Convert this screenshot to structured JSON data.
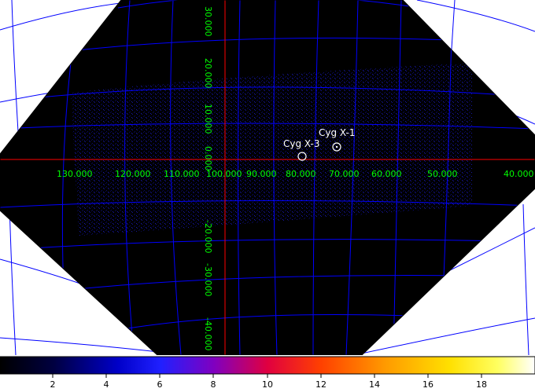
{
  "sky_map": {
    "ra_labels": [
      "130.000",
      "120.000",
      "110.000",
      "100.000",
      "90.000",
      "80.000",
      "70.000",
      "60.000",
      "50.000",
      "40.000"
    ],
    "dec_labels": [
      "30.000",
      "20.000",
      "10.000",
      "0.000",
      "-20.000",
      "-30.000",
      "-40.000"
    ],
    "sources": [
      {
        "name": "Cyg X-3",
        "label": "Cyg X-3"
      },
      {
        "name": "Cyg X-1",
        "label": "Cyg X-1"
      }
    ],
    "colors": {
      "background": "#ffffff",
      "map_fill": "#000000",
      "grid": "#0000ff",
      "axes": "#ff0000",
      "labels": "#00ff00",
      "sources": "#ffffff"
    }
  },
  "colorbar": {
    "tick_labels": [
      "2",
      "4",
      "6",
      "8",
      "10",
      "12",
      "14",
      "16",
      "18"
    ],
    "colormap_stops": [
      "#000000",
      "#000040",
      "#0000c8",
      "#2020ff",
      "#8000c0",
      "#e00040",
      "#ff4000",
      "#ff9a00",
      "#ffe000",
      "#ffff60",
      "#ffffff"
    ]
  }
}
